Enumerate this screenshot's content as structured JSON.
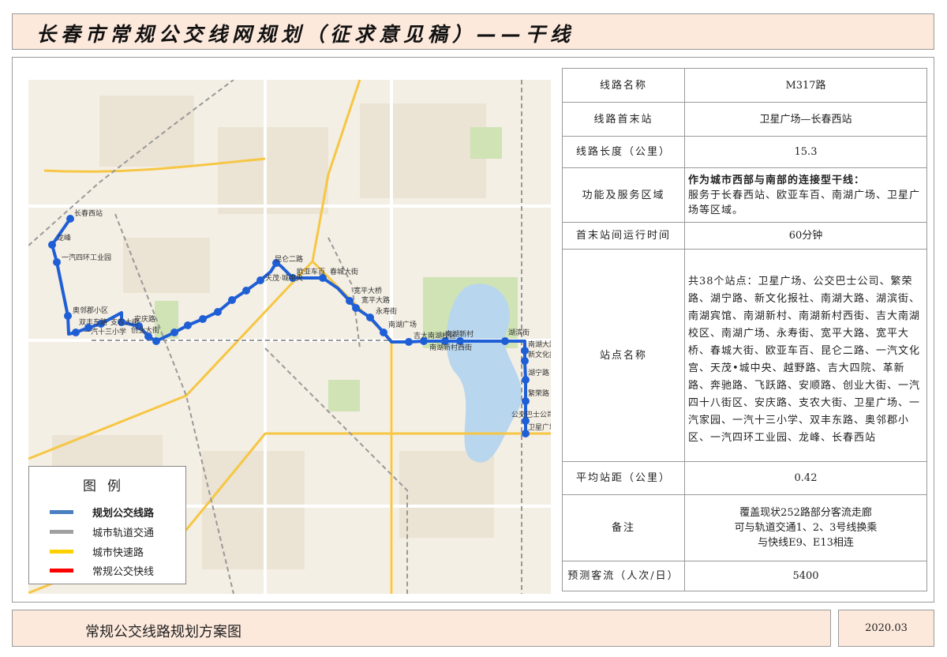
{
  "header": {
    "title": "长春市常规公交线网规划（征求意见稿）——干线"
  },
  "map": {
    "labels": [
      "长春西站",
      "龙峰",
      "一汽四环工业园",
      "奥邻郡小区",
      "双丰东路",
      "一汽十三小学",
      "支农大街",
      "安庆路",
      "创业大街",
      "昆仑二路",
      "欧亚车百",
      "春城大街",
      "宽平大桥",
      "宽平大路",
      "永寿街",
      "南湖广场",
      "吉大南湖校区",
      "南湖新村",
      "南湖新村西街",
      "湖滨街",
      "南湖大路",
      "新文化报社",
      "湖宁路",
      "繁荣路",
      "公交巴士公司",
      "卫星广场",
      "天茂·城中央"
    ],
    "route_color": "#1f5fd6"
  },
  "legend": {
    "title": "图例",
    "items": [
      {
        "label": "规划公交线路",
        "color": "#4a7fc1"
      },
      {
        "label": "城市轨道交通",
        "color": "#a0a0a0"
      },
      {
        "label": "城市快速路",
        "color": "#ffd000"
      },
      {
        "label": "常规公交快线",
        "color": "#ff0000"
      }
    ]
  },
  "table": {
    "rows": [
      {
        "key": "线路名称",
        "value": "M317路"
      },
      {
        "key": "线路首末站",
        "value": "卫星广场—长春西站"
      },
      {
        "key": "线路长度（公里）",
        "value": "15.3"
      },
      {
        "key": "功能及服务区域",
        "value_bold": "作为城市西部与南部的连接型干线：",
        "value": "服务于长春西站、欧亚车百、南湖广场、卫星广场等区域。"
      },
      {
        "key": "首末站间运行时间",
        "value": "60分钟"
      },
      {
        "key": "站点名称",
        "value": "共38个站点：卫星广场、公交巴士公司、繁荣路、湖宁路、新文化报社、南湖大路、湖滨街、南湖宾馆、南湖新村、南湖新村西街、吉大南湖校区、南湖广场、永寿街、宽平大路、宽平大桥、春城大街、欧亚车百、昆仑二路、一汽文化宫、天茂•城中央、越野路、吉大四院、革新路、奔驰路、飞跃路、安顺路、创业大街、一汽四十八街区、安庆路、支农大街、卫星广场、一汽家园、一汽十三小学、双丰东路、奥邻郡小区、一汽四环工业园、龙峰、长春西站"
      },
      {
        "key": "平均站距（公里）",
        "value": "0.42"
      },
      {
        "key": "备注",
        "lines": [
          "覆盖现状252路部分客流走廊",
          "可与轨道交通1、2、3号线换乘",
          "与快线E9、E13相连"
        ]
      },
      {
        "key": "预测客流（人次/日）",
        "value": "5400"
      }
    ]
  },
  "footer": {
    "title": "常规公交线路规划方案图",
    "date": "2020.03"
  }
}
